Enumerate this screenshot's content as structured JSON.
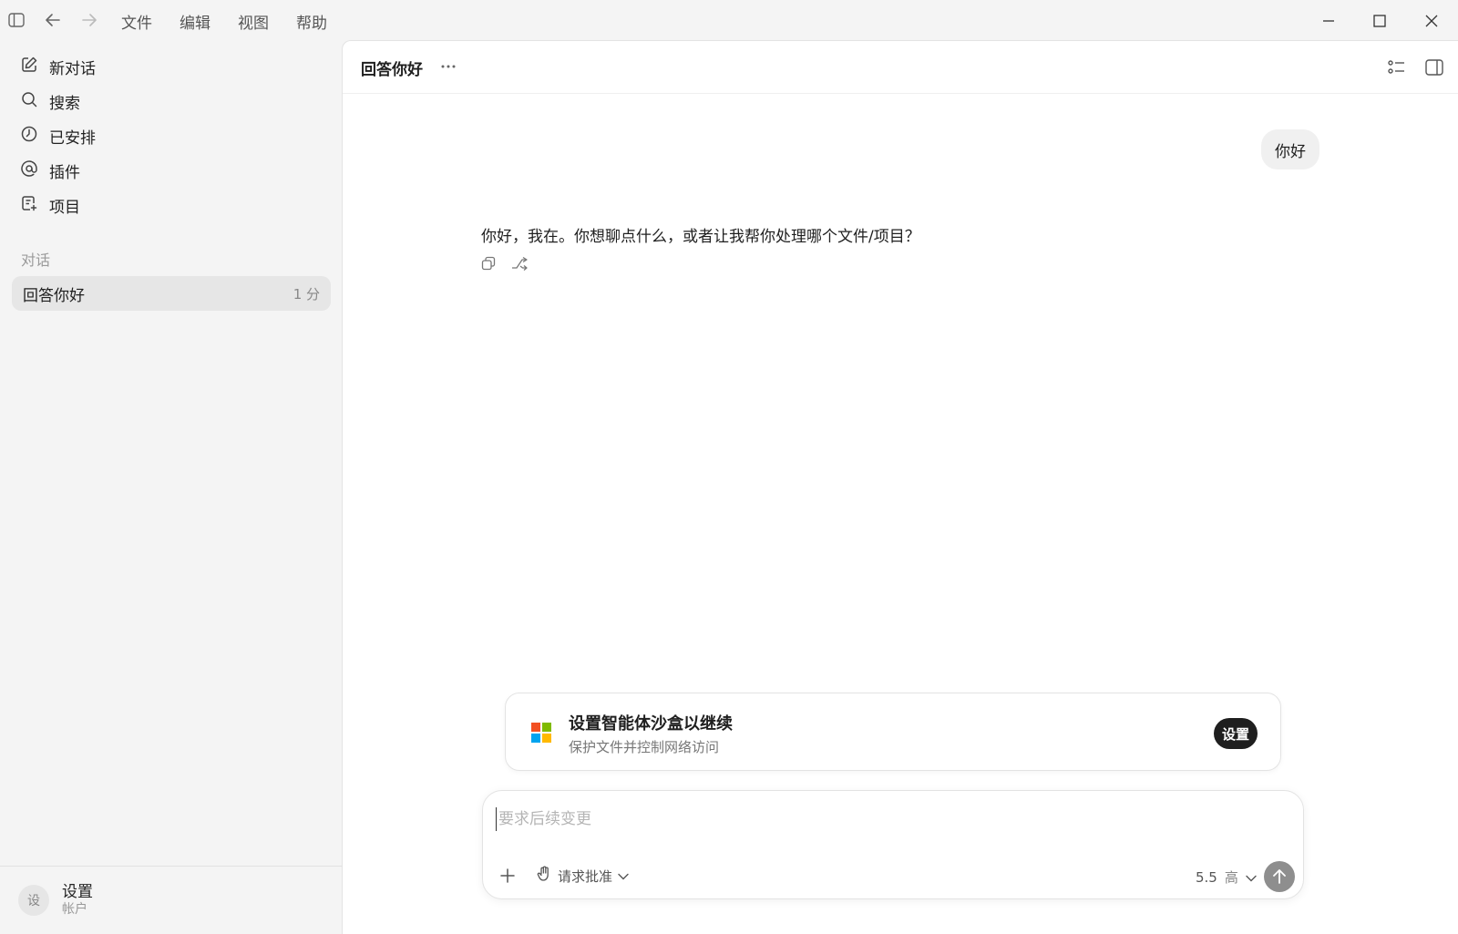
{
  "menu": [
    "文件",
    "编辑",
    "视图",
    "帮助"
  ],
  "sidebar": {
    "nav": [
      {
        "label": "新对话",
        "icon": "edit-icon"
      },
      {
        "label": "搜索",
        "icon": "search-icon"
      },
      {
        "label": "已安排",
        "icon": "clock-icon"
      },
      {
        "label": "插件",
        "icon": "at-icon"
      },
      {
        "label": "项目",
        "icon": "project-icon"
      }
    ],
    "section_label": "对话",
    "conversations": [
      {
        "title": "回答你好",
        "time": "1 分"
      }
    ],
    "account": {
      "avatar": "设",
      "name": "设置",
      "sub": "帐户"
    }
  },
  "main": {
    "title": "回答你好",
    "user_message": "你好",
    "assistant_message": "你好，我在。你想聊点什么，或者让我帮你处理哪个文件/项目？"
  },
  "sandbox_card": {
    "title": "设置智能体沙盒以继续",
    "subtitle": "保护文件并控制网络访问",
    "button": "设置",
    "logo_colors": [
      "#f25022",
      "#7fba00",
      "#00a4ef",
      "#ffb900"
    ]
  },
  "composer": {
    "placeholder": "要求后续变更",
    "approve_label": "请求批准",
    "model_version": "5.5",
    "model_level": "高"
  }
}
